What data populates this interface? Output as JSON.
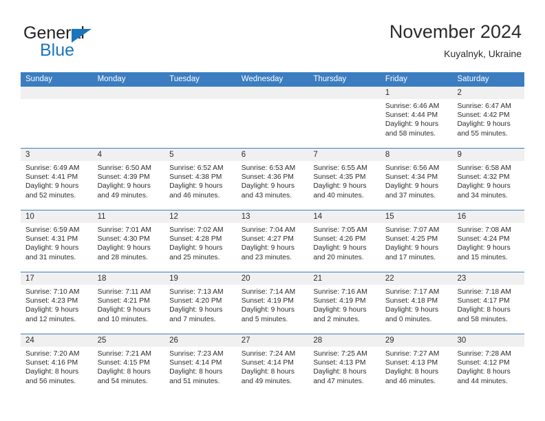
{
  "brand": {
    "name_part1": "General",
    "name_part2": "Blue",
    "triangle_color": "#1b75bb"
  },
  "header": {
    "title": "November 2024",
    "subtitle": "Kuyalnyk, Ukraine"
  },
  "theme": {
    "header_blue": "#3b7dc0",
    "date_band": "#f0f0f0",
    "text": "#2b2b2b"
  },
  "weekdays": [
    "Sunday",
    "Monday",
    "Tuesday",
    "Wednesday",
    "Thursday",
    "Friday",
    "Saturday"
  ],
  "labels": {
    "sunrise_prefix": "Sunrise: ",
    "sunset_prefix": "Sunset: ",
    "daylight_prefix": "Daylight: "
  },
  "weeks": [
    [
      {
        "day": "",
        "empty": true
      },
      {
        "day": "",
        "empty": true
      },
      {
        "day": "",
        "empty": true
      },
      {
        "day": "",
        "empty": true
      },
      {
        "day": "",
        "empty": true
      },
      {
        "day": "1",
        "sunrise": "Sunrise: 6:46 AM",
        "sunset": "Sunset: 4:44 PM",
        "daylight": "Daylight: 9 hours and 58 minutes."
      },
      {
        "day": "2",
        "sunrise": "Sunrise: 6:47 AM",
        "sunset": "Sunset: 4:42 PM",
        "daylight": "Daylight: 9 hours and 55 minutes."
      }
    ],
    [
      {
        "day": "3",
        "sunrise": "Sunrise: 6:49 AM",
        "sunset": "Sunset: 4:41 PM",
        "daylight": "Daylight: 9 hours and 52 minutes."
      },
      {
        "day": "4",
        "sunrise": "Sunrise: 6:50 AM",
        "sunset": "Sunset: 4:39 PM",
        "daylight": "Daylight: 9 hours and 49 minutes."
      },
      {
        "day": "5",
        "sunrise": "Sunrise: 6:52 AM",
        "sunset": "Sunset: 4:38 PM",
        "daylight": "Daylight: 9 hours and 46 minutes."
      },
      {
        "day": "6",
        "sunrise": "Sunrise: 6:53 AM",
        "sunset": "Sunset: 4:36 PM",
        "daylight": "Daylight: 9 hours and 43 minutes."
      },
      {
        "day": "7",
        "sunrise": "Sunrise: 6:55 AM",
        "sunset": "Sunset: 4:35 PM",
        "daylight": "Daylight: 9 hours and 40 minutes."
      },
      {
        "day": "8",
        "sunrise": "Sunrise: 6:56 AM",
        "sunset": "Sunset: 4:34 PM",
        "daylight": "Daylight: 9 hours and 37 minutes."
      },
      {
        "day": "9",
        "sunrise": "Sunrise: 6:58 AM",
        "sunset": "Sunset: 4:32 PM",
        "daylight": "Daylight: 9 hours and 34 minutes."
      }
    ],
    [
      {
        "day": "10",
        "sunrise": "Sunrise: 6:59 AM",
        "sunset": "Sunset: 4:31 PM",
        "daylight": "Daylight: 9 hours and 31 minutes."
      },
      {
        "day": "11",
        "sunrise": "Sunrise: 7:01 AM",
        "sunset": "Sunset: 4:30 PM",
        "daylight": "Daylight: 9 hours and 28 minutes."
      },
      {
        "day": "12",
        "sunrise": "Sunrise: 7:02 AM",
        "sunset": "Sunset: 4:28 PM",
        "daylight": "Daylight: 9 hours and 25 minutes."
      },
      {
        "day": "13",
        "sunrise": "Sunrise: 7:04 AM",
        "sunset": "Sunset: 4:27 PM",
        "daylight": "Daylight: 9 hours and 23 minutes."
      },
      {
        "day": "14",
        "sunrise": "Sunrise: 7:05 AM",
        "sunset": "Sunset: 4:26 PM",
        "daylight": "Daylight: 9 hours and 20 minutes."
      },
      {
        "day": "15",
        "sunrise": "Sunrise: 7:07 AM",
        "sunset": "Sunset: 4:25 PM",
        "daylight": "Daylight: 9 hours and 17 minutes."
      },
      {
        "day": "16",
        "sunrise": "Sunrise: 7:08 AM",
        "sunset": "Sunset: 4:24 PM",
        "daylight": "Daylight: 9 hours and 15 minutes."
      }
    ],
    [
      {
        "day": "17",
        "sunrise": "Sunrise: 7:10 AM",
        "sunset": "Sunset: 4:23 PM",
        "daylight": "Daylight: 9 hours and 12 minutes."
      },
      {
        "day": "18",
        "sunrise": "Sunrise: 7:11 AM",
        "sunset": "Sunset: 4:21 PM",
        "daylight": "Daylight: 9 hours and 10 minutes."
      },
      {
        "day": "19",
        "sunrise": "Sunrise: 7:13 AM",
        "sunset": "Sunset: 4:20 PM",
        "daylight": "Daylight: 9 hours and 7 minutes."
      },
      {
        "day": "20",
        "sunrise": "Sunrise: 7:14 AM",
        "sunset": "Sunset: 4:19 PM",
        "daylight": "Daylight: 9 hours and 5 minutes."
      },
      {
        "day": "21",
        "sunrise": "Sunrise: 7:16 AM",
        "sunset": "Sunset: 4:19 PM",
        "daylight": "Daylight: 9 hours and 2 minutes."
      },
      {
        "day": "22",
        "sunrise": "Sunrise: 7:17 AM",
        "sunset": "Sunset: 4:18 PM",
        "daylight": "Daylight: 9 hours and 0 minutes."
      },
      {
        "day": "23",
        "sunrise": "Sunrise: 7:18 AM",
        "sunset": "Sunset: 4:17 PM",
        "daylight": "Daylight: 8 hours and 58 minutes."
      }
    ],
    [
      {
        "day": "24",
        "sunrise": "Sunrise: 7:20 AM",
        "sunset": "Sunset: 4:16 PM",
        "daylight": "Daylight: 8 hours and 56 minutes."
      },
      {
        "day": "25",
        "sunrise": "Sunrise: 7:21 AM",
        "sunset": "Sunset: 4:15 PM",
        "daylight": "Daylight: 8 hours and 54 minutes."
      },
      {
        "day": "26",
        "sunrise": "Sunrise: 7:23 AM",
        "sunset": "Sunset: 4:14 PM",
        "daylight": "Daylight: 8 hours and 51 minutes."
      },
      {
        "day": "27",
        "sunrise": "Sunrise: 7:24 AM",
        "sunset": "Sunset: 4:14 PM",
        "daylight": "Daylight: 8 hours and 49 minutes."
      },
      {
        "day": "28",
        "sunrise": "Sunrise: 7:25 AM",
        "sunset": "Sunset: 4:13 PM",
        "daylight": "Daylight: 8 hours and 47 minutes."
      },
      {
        "day": "29",
        "sunrise": "Sunrise: 7:27 AM",
        "sunset": "Sunset: 4:13 PM",
        "daylight": "Daylight: 8 hours and 46 minutes."
      },
      {
        "day": "30",
        "sunrise": "Sunrise: 7:28 AM",
        "sunset": "Sunset: 4:12 PM",
        "daylight": "Daylight: 8 hours and 44 minutes."
      }
    ]
  ]
}
